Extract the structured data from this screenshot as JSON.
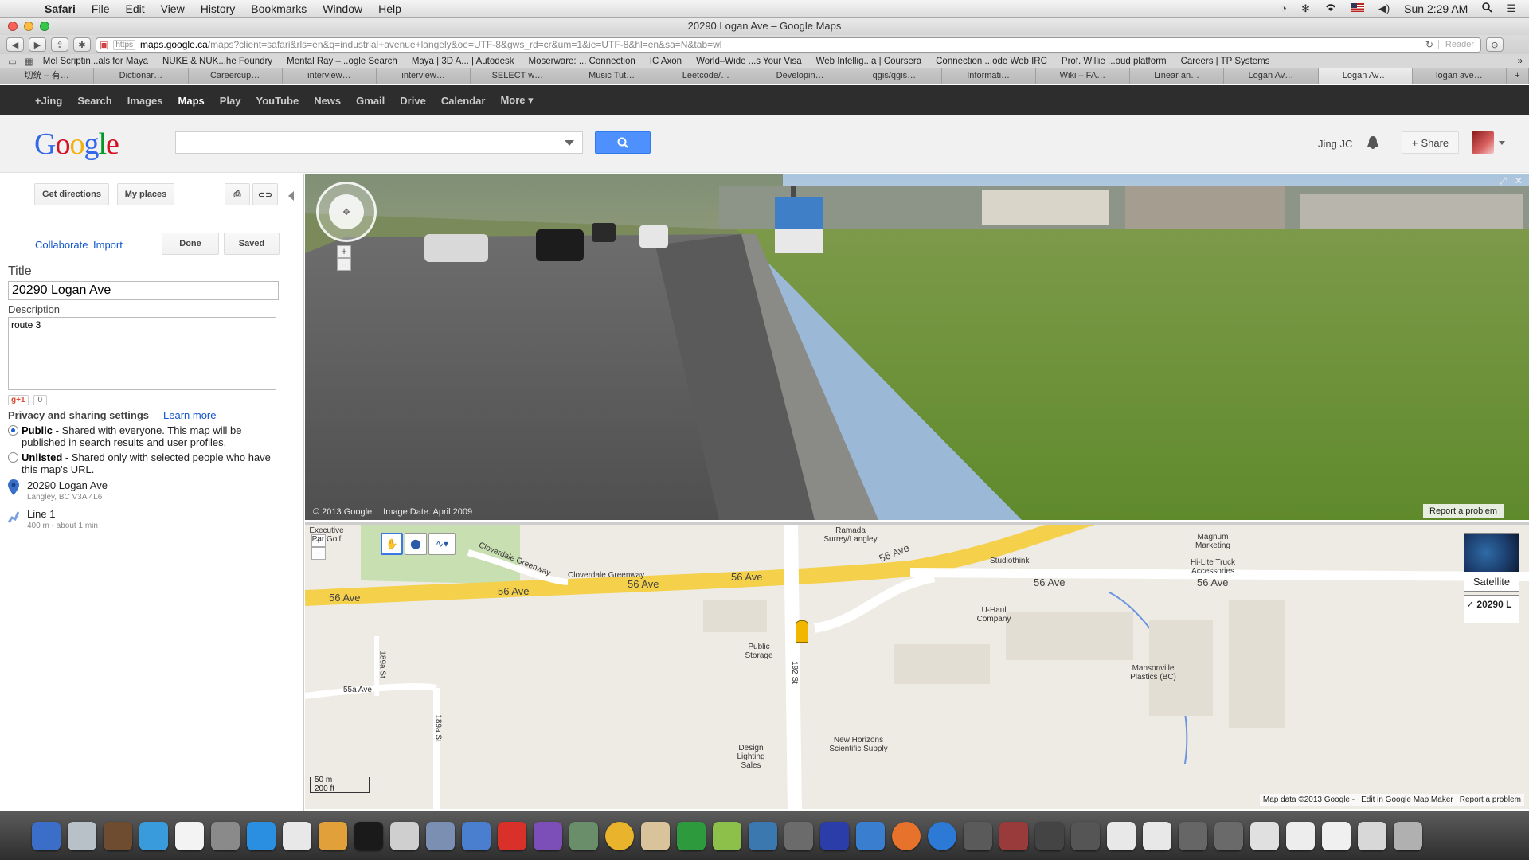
{
  "menubar": {
    "app": "Safari",
    "items": [
      "File",
      "Edit",
      "View",
      "History",
      "Bookmarks",
      "Window",
      "Help"
    ],
    "clock": "Sun 2:29 AM"
  },
  "window": {
    "title": "20290 Logan Ave – Google Maps"
  },
  "toolbar": {
    "url_scheme": "https",
    "url_host": "maps.google.ca",
    "url_path": "/maps?client=safari&rls=en&q=industrial+avenue+langely&oe=UTF-8&gws_rd=cr&um=1&ie=UTF-8&hl=en&sa=N&tab=wl",
    "reader": "Reader"
  },
  "bookmarks": [
    "Mel Scriptin...als for Maya",
    "NUKE & NUK...he Foundry",
    "Mental Ray –...ogle Search",
    "Maya | 3D A... | Autodesk",
    "Moserware: ... Connection",
    "IC Axon",
    "World–Wide ...s Your Visa",
    "Web Intellig...a | Coursera",
    "Connection ...ode Web IRC",
    "Prof. Willie ...oud platform",
    "Careers | TP Systems"
  ],
  "tabs": [
    "切统 – 有…",
    "Dictionar…",
    "Careercup…",
    "interview…",
    "interview…",
    "SELECT w…",
    "Music Tut…",
    "Leetcode/…",
    "Developin…",
    "qgis/qgis…",
    "Informati…",
    "Wiki – FA…",
    "Linear an…",
    "Logan Av…",
    "Logan Av…",
    "logan ave…"
  ],
  "gbar": [
    "+Jing",
    "Search",
    "Images",
    "Maps",
    "Play",
    "YouTube",
    "News",
    "Gmail",
    "Drive",
    "Calendar",
    "More ▾"
  ],
  "header": {
    "logo": "Google",
    "user": "Jing JC",
    "share": "Share"
  },
  "panel": {
    "get_directions": "Get directions",
    "my_places": "My places",
    "collaborate": "Collaborate",
    "import": "Import",
    "done": "Done",
    "saved": "Saved",
    "title_label": "Title",
    "title_value": "20290 Logan Ave",
    "description_label": "Description",
    "description_value": "route 3",
    "plusone_count": "0",
    "privacy_heading": "Privacy and sharing settings",
    "learn_more": "Learn more",
    "public_label": "Public",
    "public_desc": " - Shared with everyone. This map will be published in search results and user profiles.",
    "unlisted_label": "Unlisted",
    "unlisted_desc": " - Shared only with selected people who have this map's URL.",
    "features": [
      {
        "title": "20290 Logan Ave",
        "sub": "Langley, BC V3A 4L6"
      },
      {
        "title": "Line 1",
        "sub": "400 m - about 1 min"
      }
    ]
  },
  "streetview": {
    "copyright": "© 2013 Google",
    "image_date": "Image Date: April 2009",
    "report": "Report a problem"
  },
  "map": {
    "roads": [
      "56 Ave",
      "56 Ave",
      "56 Ave",
      "56 Ave",
      "56 Ave",
      "56 Ave",
      "Cloverdale Greenway",
      "Cloverdale Greenway",
      "192 St",
      "55a Ave",
      "189a St",
      "189a St",
      "56 Ave"
    ],
    "places": [
      "Ramada Surrey/Langley",
      "Studiothink",
      "Magnum Marketing",
      "Hi-Lite Truck Accessories",
      "U-Haul Company",
      "Public Storage",
      "Mansonville Plastics (BC)",
      "New Horizons Scientific Supply",
      "Design Lighting Sales",
      "Executive Par Golf"
    ],
    "satellite": "Satellite",
    "layer": "✓ 20290 L",
    "scale_m": "50 m",
    "scale_ft": "200 ft",
    "map_data": "Map data ©2013 Google -",
    "edit_mapmaker": "Edit in Google Map Maker",
    "report": "Report a problem"
  }
}
